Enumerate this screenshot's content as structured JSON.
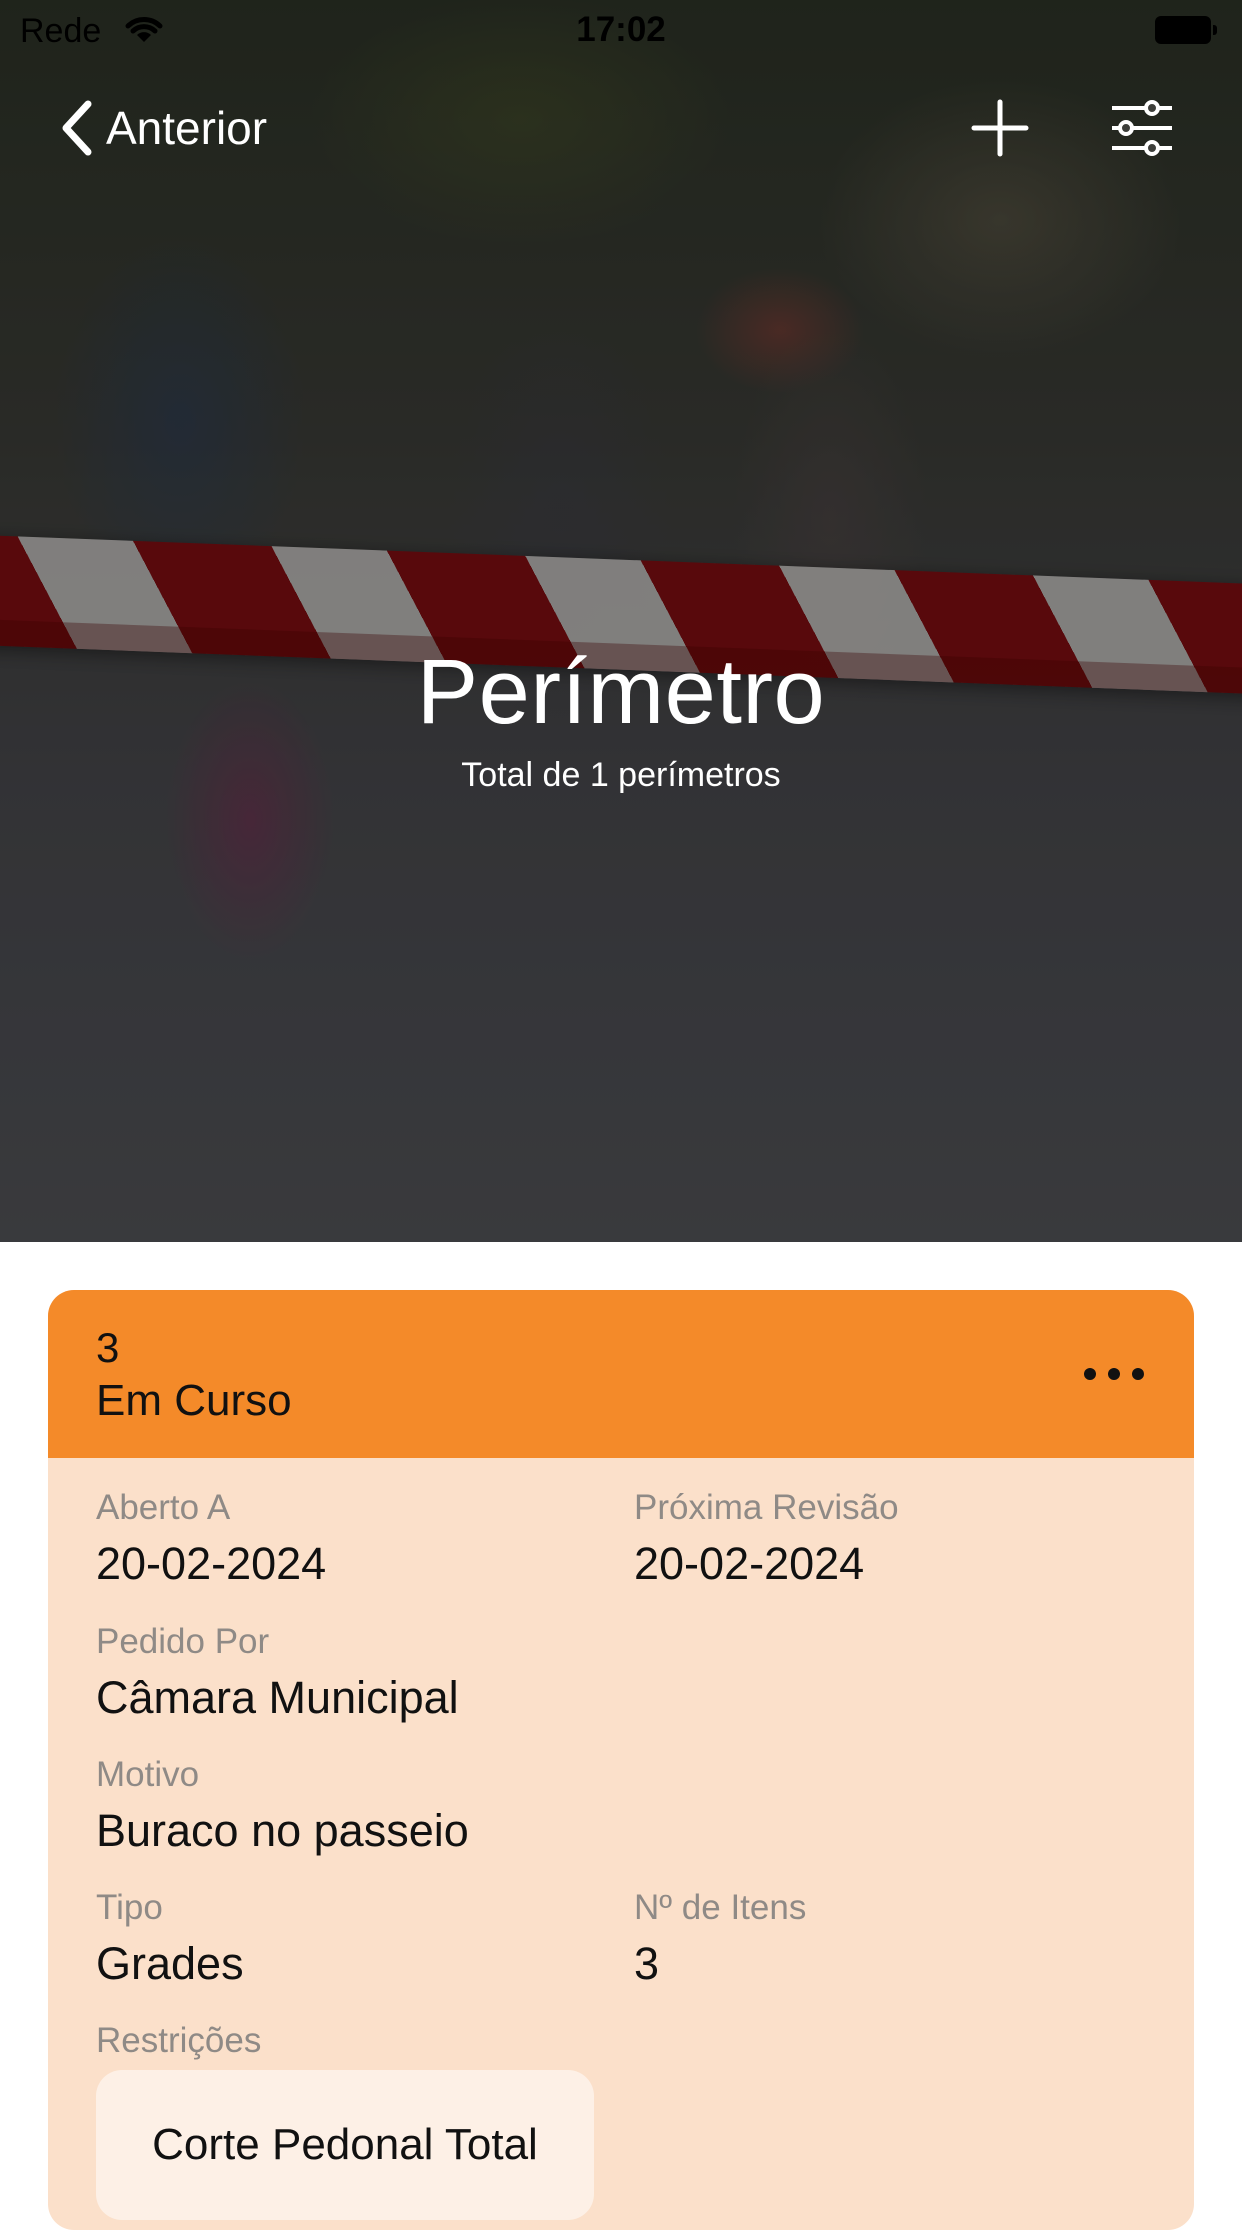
{
  "status_bar": {
    "carrier": "Rede",
    "time": "17:02"
  },
  "nav": {
    "back_label": "Anterior"
  },
  "header": {
    "title": "Perímetro",
    "subtitle": "Total de 1 perímetros"
  },
  "perimeter_card": {
    "id": "3",
    "status": "Em Curso",
    "accent_color": "#f48a29",
    "body_color": "#fbe0ca",
    "fields": {
      "opened_at": {
        "label": "Aberto A",
        "value": "20-02-2024"
      },
      "next_review": {
        "label": "Próxima Revisão",
        "value": "20-02-2024"
      },
      "requested_by": {
        "label": "Pedido Por",
        "value": "Câmara Municipal"
      },
      "reason": {
        "label": "Motivo",
        "value": "Buraco no passeio"
      },
      "type": {
        "label": "Tipo",
        "value": "Grades"
      },
      "item_count": {
        "label": "Nº de Itens",
        "value": "3"
      },
      "restrictions": {
        "label": "Restrições",
        "values": [
          "Corte Pedonal Total"
        ]
      }
    }
  },
  "icons": [
    "wifi-icon",
    "battery-icon",
    "chevron-left-icon",
    "plus-icon",
    "sliders-icon",
    "ellipsis-icon"
  ]
}
